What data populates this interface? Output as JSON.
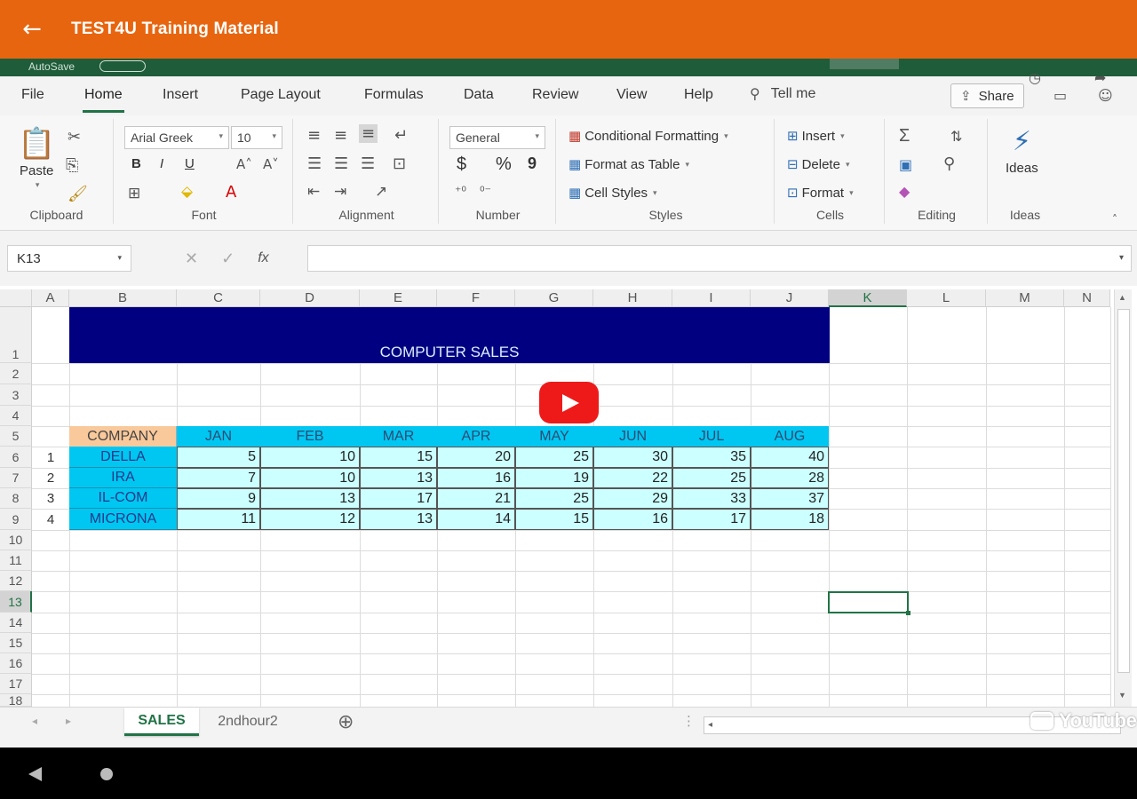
{
  "app_bar": {
    "back_icon": "←",
    "title": "TEST4U Training Material"
  },
  "excel": {
    "autosave": "AutoSave",
    "tabs": [
      {
        "label": "File"
      },
      {
        "label": "Home"
      },
      {
        "label": "Insert"
      },
      {
        "label": "Page Layout"
      },
      {
        "label": "Formulas"
      },
      {
        "label": "Data"
      },
      {
        "label": "Review"
      },
      {
        "label": "View"
      },
      {
        "label": "Help"
      }
    ],
    "tell_me": "Tell me",
    "share": "Share",
    "ribbon": {
      "clipboard": {
        "paste": "Paste",
        "label": "Clipboard"
      },
      "font": {
        "name": "Arial Greek",
        "size": "10",
        "label": "Font",
        "bold": "B",
        "italic": "I",
        "underline": "U"
      },
      "alignment": {
        "label": "Alignment"
      },
      "number": {
        "format": "General",
        "currency": "$",
        "percent": "%",
        "comma": "9",
        "label": "Number"
      },
      "styles": {
        "conditional": "Conditional Formatting",
        "format_table": "Format as Table",
        "cell_styles": "Cell Styles",
        "label": "Styles"
      },
      "cells": {
        "insert": "Insert",
        "delete": "Delete",
        "format": "Format",
        "label": "Cells"
      },
      "editing": {
        "sum": "Σ",
        "label": "Editing"
      },
      "ideas": {
        "button": "Ideas",
        "label": "Ideas"
      }
    },
    "formula_bar": {
      "name_box": "K13",
      "fx": "fx",
      "cancel": "✕",
      "enter": "✓",
      "value": ""
    },
    "columns": [
      "A",
      "B",
      "C",
      "D",
      "E",
      "F",
      "G",
      "H",
      "I",
      "J",
      "K",
      "L",
      "M",
      "N"
    ],
    "rows": [
      "1",
      "2",
      "3",
      "4",
      "5",
      "6",
      "7",
      "8",
      "9",
      "10",
      "11",
      "12",
      "13",
      "14",
      "15",
      "16",
      "17",
      "18"
    ],
    "sheet": {
      "title": "COMPUTER SALES",
      "header": {
        "company": "COMPANY",
        "months": [
          "JAN",
          "FEB",
          "MAR",
          "APR",
          "MAY",
          "JUN",
          "JUL",
          "AUG"
        ]
      },
      "data": [
        {
          "no": "1",
          "company": "DELLA",
          "values": [
            "5",
            "10",
            "15",
            "20",
            "25",
            "30",
            "35",
            "40"
          ]
        },
        {
          "no": "2",
          "company": "IRA",
          "values": [
            "7",
            "10",
            "13",
            "16",
            "19",
            "22",
            "25",
            "28"
          ]
        },
        {
          "no": "3",
          "company": "IL-COM",
          "values": [
            "9",
            "13",
            "17",
            "21",
            "25",
            "29",
            "33",
            "37"
          ]
        },
        {
          "no": "4",
          "company": "MICRONA",
          "values": [
            "11",
            "12",
            "13",
            "14",
            "15",
            "16",
            "17",
            "18"
          ]
        }
      ]
    },
    "sheet_tabs": [
      {
        "label": "SALES"
      },
      {
        "label": "2ndhour2"
      }
    ],
    "add_sheet": "⊕"
  },
  "youtube": "YouTube",
  "colors": {
    "accent_orange": "#e8650f",
    "excel_green": "#217346",
    "title_navy": "#010080",
    "header_cyan": "#00c7f2",
    "data_cyan": "#ccffff",
    "company_tan": "#f9c99b",
    "play_red": "#ee1a1a"
  }
}
